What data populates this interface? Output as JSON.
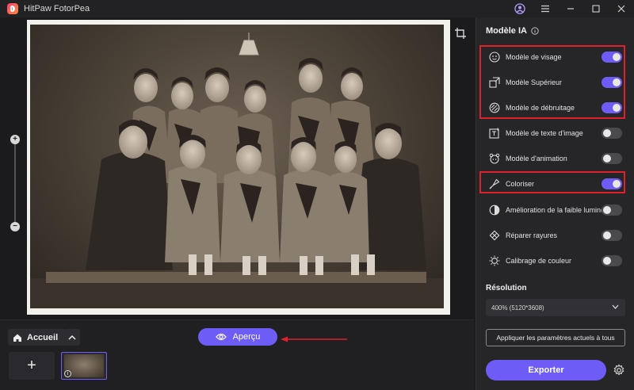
{
  "app": {
    "title": "HitPaw FotorPea"
  },
  "bottom": {
    "home_label": "Accueil",
    "preview_label": "Aperçu",
    "add_symbol": "+"
  },
  "panel": {
    "title": "Modèle IA",
    "features": [
      {
        "label": "Modèle de visage",
        "icon": "face-icon",
        "enabled": true
      },
      {
        "label": "Modèle Supérieur",
        "icon": "upscale-icon",
        "enabled": true
      },
      {
        "label": "Modèle de débruitage",
        "icon": "denoise-icon",
        "enabled": true
      },
      {
        "label": "Modèle de texte d'image",
        "icon": "text-image-icon",
        "enabled": false
      },
      {
        "label": "Modèle d'animation",
        "icon": "animation-icon",
        "enabled": false
      },
      {
        "label": "Coloriser",
        "icon": "colorize-icon",
        "enabled": true
      },
      {
        "label": "Amélioration de la faible luminosité",
        "icon": "low-light-icon",
        "enabled": false
      },
      {
        "label": "Réparer rayures",
        "icon": "scratch-repair-icon",
        "enabled": false
      },
      {
        "label": "Calibrage de couleur",
        "icon": "color-calibration-icon",
        "enabled": false
      }
    ],
    "resolution_title": "Résolution",
    "resolution_value": "400% (5120*3608)",
    "apply_label": "Appliquer les paramètres actuels à tous",
    "export_label": "Exporter"
  },
  "colors": {
    "accent": "#6d5cf6",
    "highlight": "#e0202c",
    "background": "#1b1b1d",
    "panel": "#262629"
  }
}
